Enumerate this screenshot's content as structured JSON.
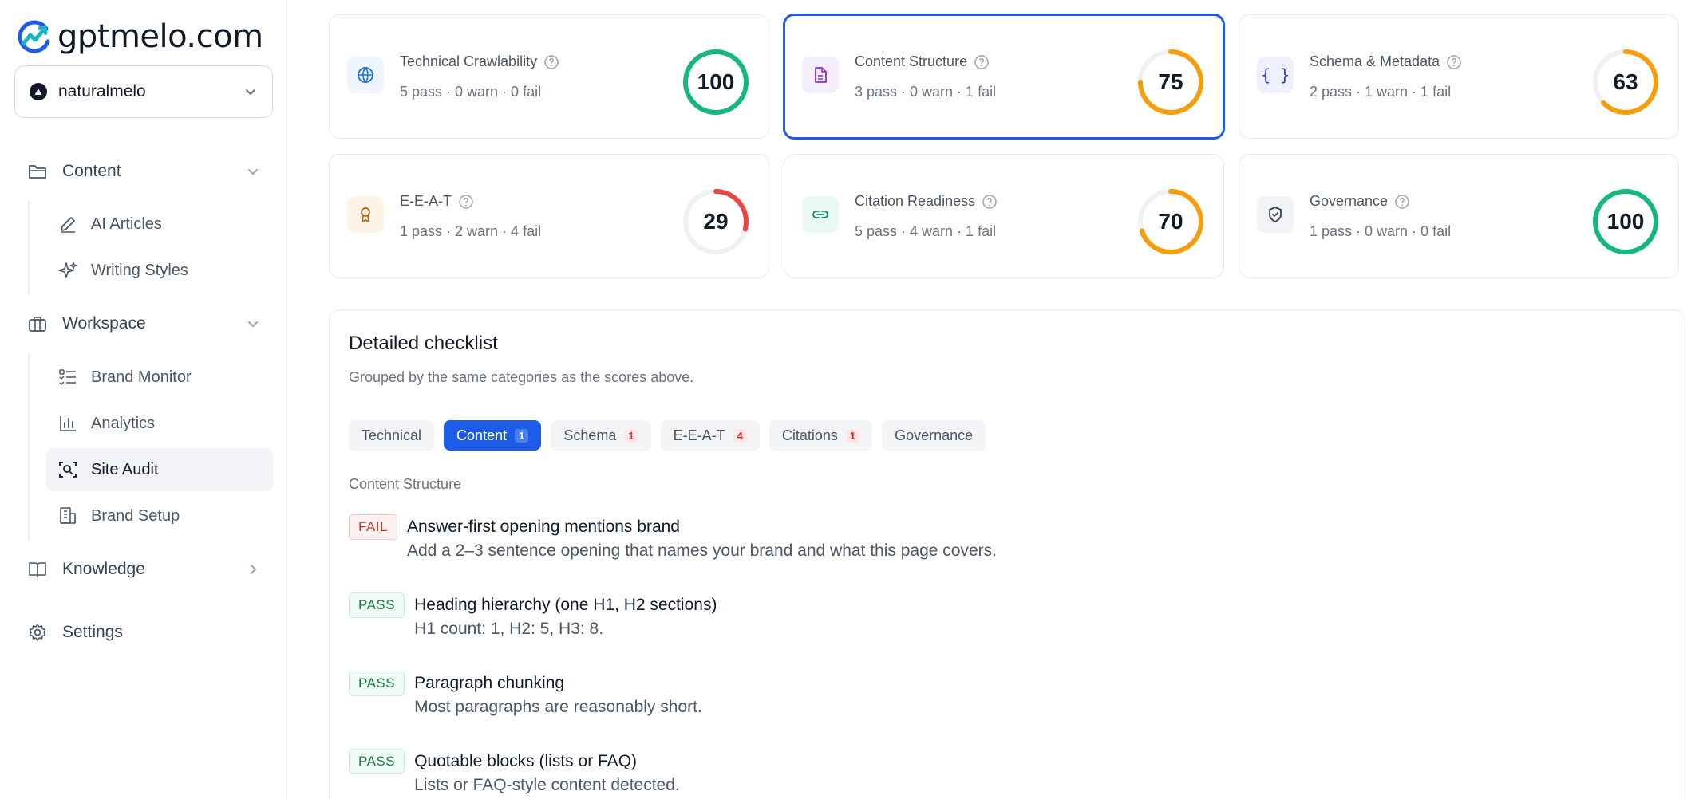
{
  "brand": {
    "name": "gptmelo.com"
  },
  "workspace": {
    "name": "naturalmelo"
  },
  "sidebar": {
    "content_label": "Content",
    "ai_articles": "AI Articles",
    "writing_styles": "Writing Styles",
    "workspace_label": "Workspace",
    "brand_monitor": "Brand Monitor",
    "analytics": "Analytics",
    "site_audit": "Site Audit",
    "brand_setup": "Brand Setup",
    "knowledge_label": "Knowledge",
    "settings_label": "Settings"
  },
  "scores": [
    {
      "title": "Technical Crawlability",
      "summary": "5 pass · 0 warn · 0 fail",
      "score": "100",
      "value": 100,
      "color": "#16b77a",
      "icon": "globe-icon"
    },
    {
      "title": "Content Structure",
      "summary": "3 pass · 0 warn · 1 fail",
      "score": "75",
      "value": 75,
      "color": "#f59e0b",
      "icon": "document-icon"
    },
    {
      "title": "Schema & Metadata",
      "summary": "2 pass · 1 warn · 1 fail",
      "score": "63",
      "value": 63,
      "color": "#f59e0b",
      "icon": "braces-icon"
    },
    {
      "title": "E-E-A-T",
      "summary": "1 pass · 2 warn · 4 fail",
      "score": "29",
      "value": 29,
      "color": "#ef4444",
      "icon": "award-icon"
    },
    {
      "title": "Citation Readiness",
      "summary": "5 pass · 4 warn · 1 fail",
      "score": "70",
      "value": 70,
      "color": "#f59e0b",
      "icon": "link-icon"
    },
    {
      "title": "Governance",
      "summary": "1 pass · 0 warn · 0 fail",
      "score": "100",
      "value": 100,
      "color": "#16b77a",
      "icon": "shield-icon"
    }
  ],
  "checklist": {
    "title": "Detailed checklist",
    "subtitle": "Grouped by the same categories as the scores above.",
    "tabs": [
      {
        "label": "Technical",
        "count": ""
      },
      {
        "label": "Content",
        "count": "1"
      },
      {
        "label": "Schema",
        "count": "1"
      },
      {
        "label": "E-E-A-T",
        "count": "4"
      },
      {
        "label": "Citations",
        "count": "1"
      },
      {
        "label": "Governance",
        "count": ""
      }
    ],
    "section": "Content Structure",
    "items": [
      {
        "status": "FAIL",
        "title": "Answer-first opening mentions brand",
        "detail": "Add a 2–3 sentence opening that names your brand and what this page covers."
      },
      {
        "status": "PASS",
        "title": "Heading hierarchy (one H1, H2 sections)",
        "detail": "H1 count: 1, H2: 5, H3: 8."
      },
      {
        "status": "PASS",
        "title": "Paragraph chunking",
        "detail": "Most paragraphs are reasonably short."
      },
      {
        "status": "PASS",
        "title": "Quotable blocks (lists or FAQ)",
        "detail": "Lists or FAQ-style content detected."
      }
    ]
  }
}
